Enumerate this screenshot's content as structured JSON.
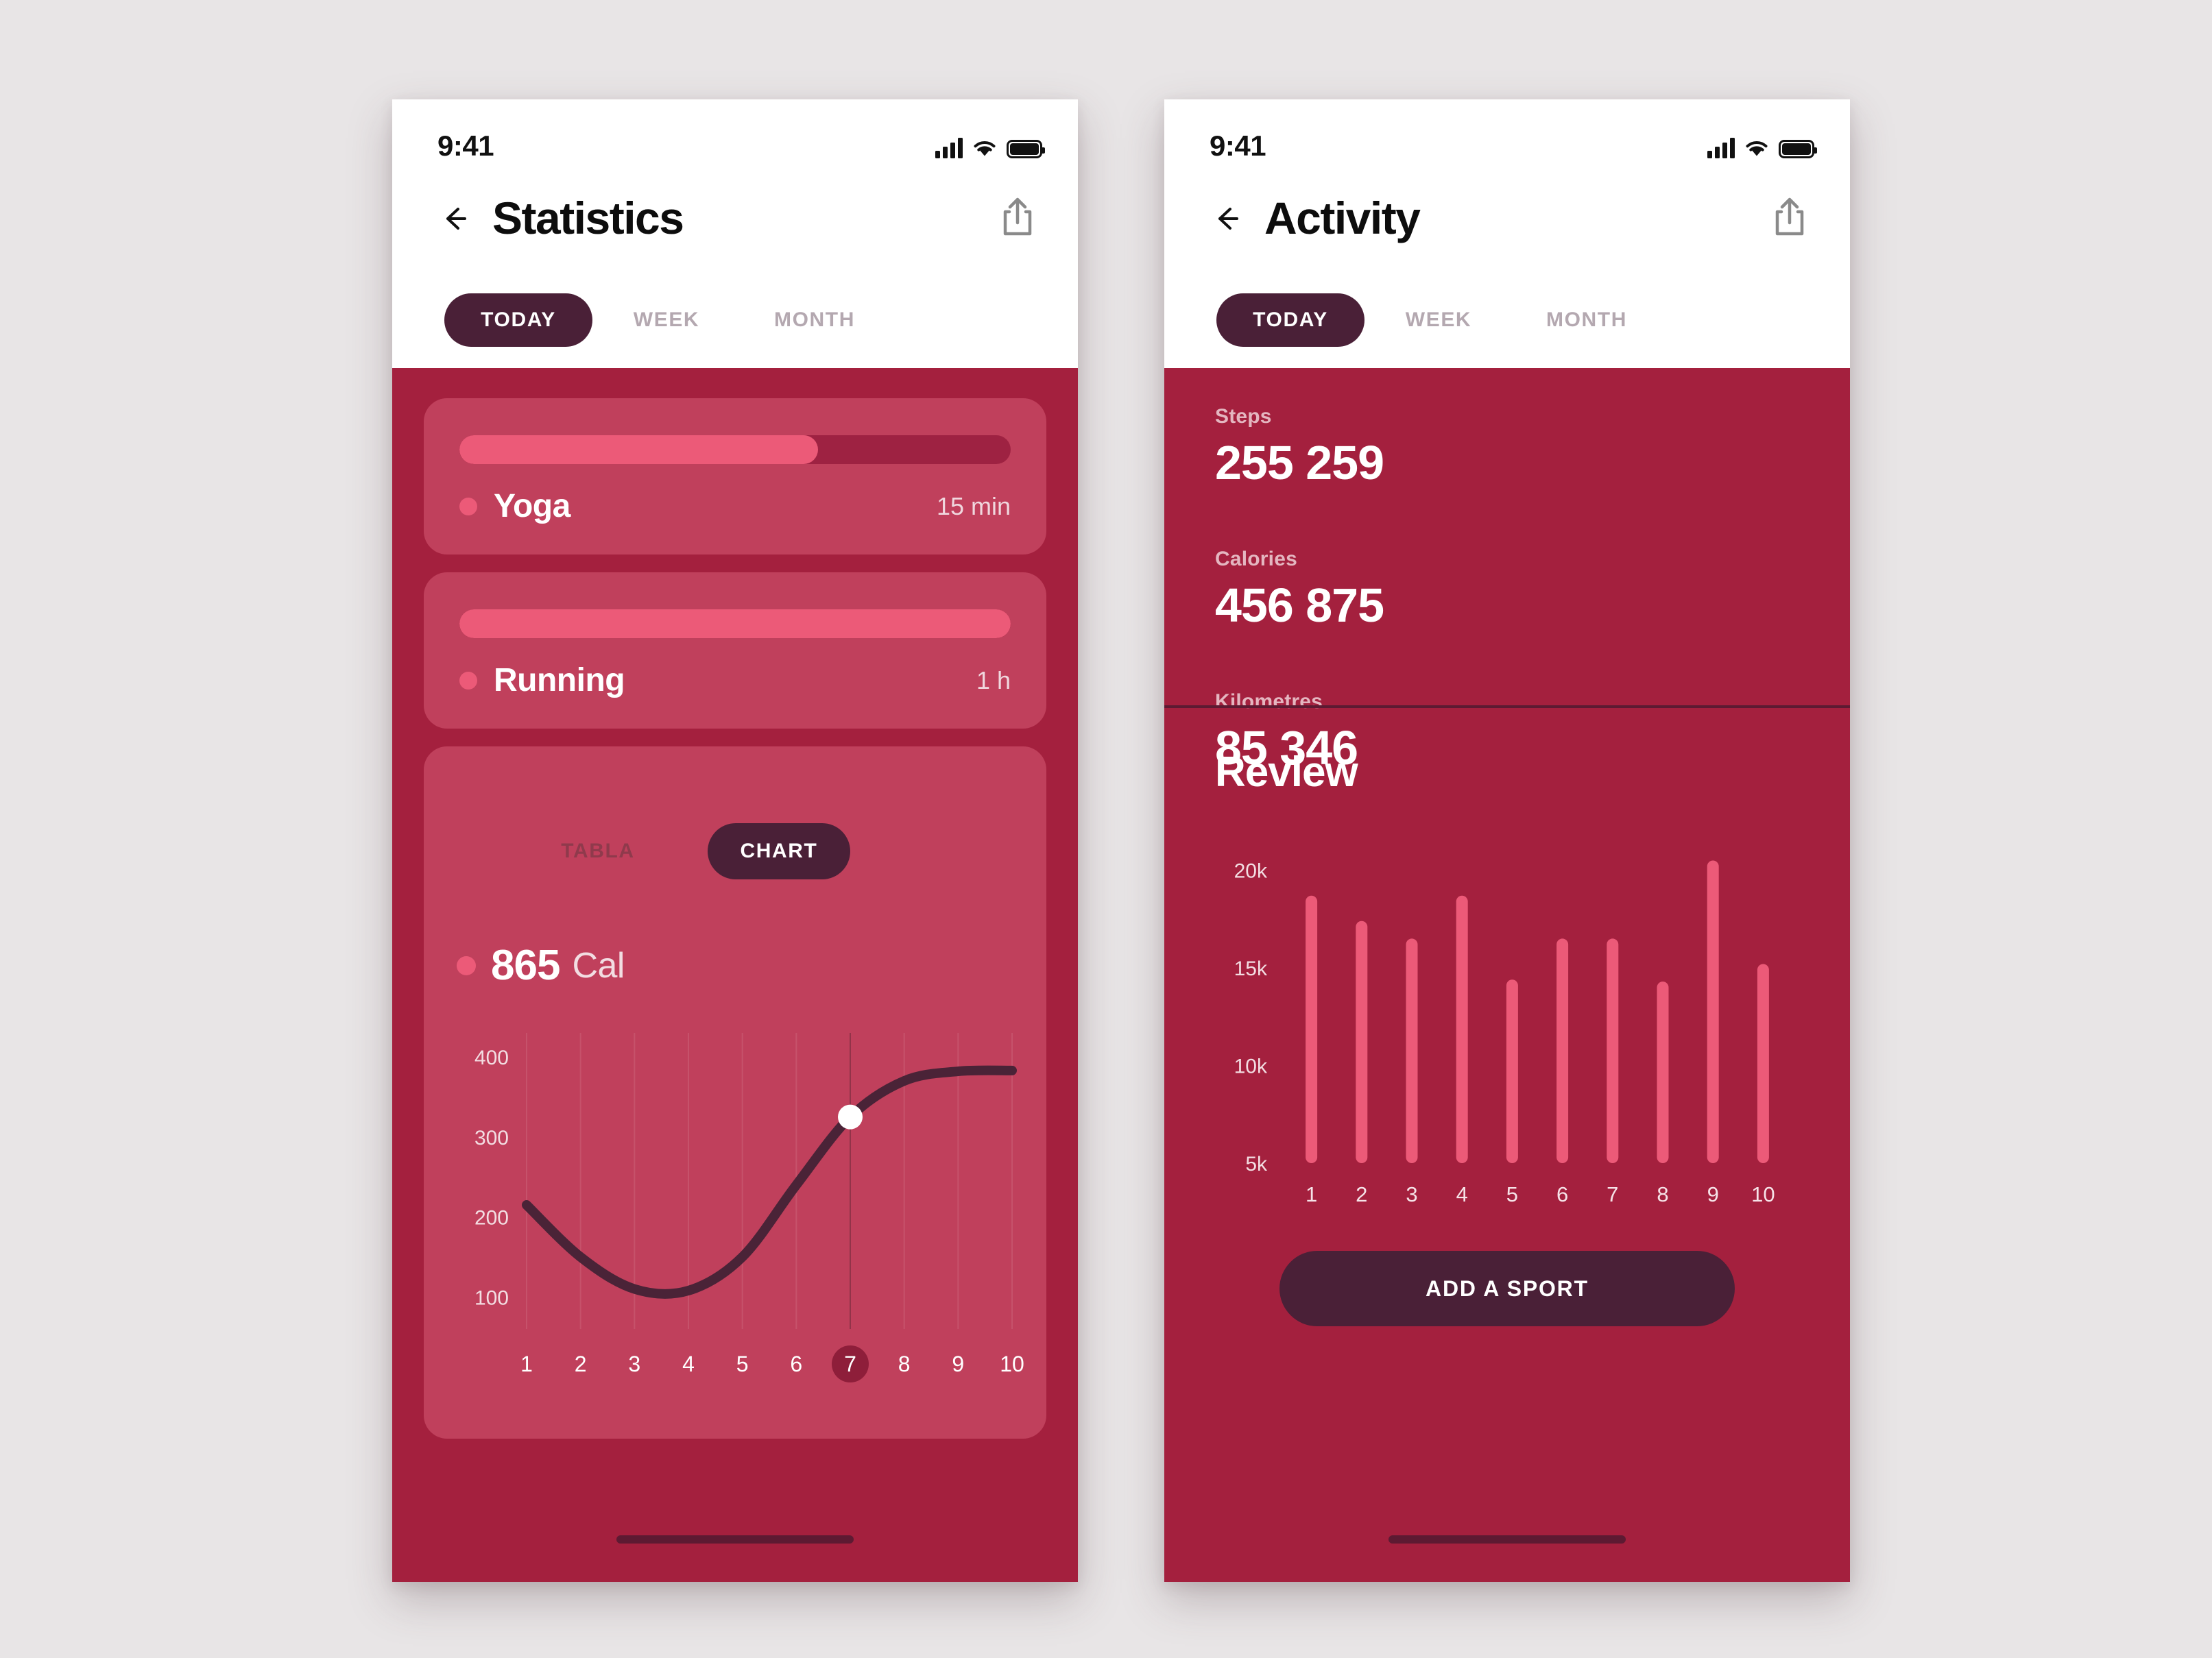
{
  "theme": {
    "page_bg": "#E8E5E6",
    "screen_bg": "#A4203E",
    "card_bg": "#C0405C",
    "accent_pink": "#EC5A78",
    "dark_plum": "#4A2037",
    "track": "#9E2242",
    "muted_tab": "#B4A8B0"
  },
  "screens": [
    {
      "id": "statistics",
      "status_bar": {
        "time": "9:41",
        "signal_icon": "cellular-signal-icon",
        "wifi_icon": "wifi-icon",
        "battery_icon": "battery-full-icon"
      },
      "nav": {
        "back_icon": "arrow-left-icon",
        "title": "Statistics",
        "share_icon": "share-icon"
      },
      "tabs": [
        {
          "label": "TODAY",
          "active": true
        },
        {
          "label": "WEEK",
          "active": false
        },
        {
          "label": "MONTH",
          "active": false
        }
      ],
      "activities": [
        {
          "name": "Yoga",
          "duration": "15 min",
          "progress_percent": 65
        },
        {
          "name": "Running",
          "duration": "1 h",
          "progress_percent": 100
        }
      ],
      "chart_card": {
        "segments": [
          {
            "label": "TABLA",
            "active": false
          },
          {
            "label": "CHART",
            "active": true
          }
        ],
        "total_value": "865",
        "total_unit": "Cal"
      }
    },
    {
      "id": "activity",
      "status_bar": {
        "time": "9:41",
        "signal_icon": "cellular-signal-icon",
        "wifi_icon": "wifi-icon",
        "battery_icon": "battery-full-icon"
      },
      "nav": {
        "back_icon": "arrow-left-icon",
        "title": "Activity",
        "share_icon": "share-icon"
      },
      "tabs": [
        {
          "label": "TODAY",
          "active": true
        },
        {
          "label": "WEEK",
          "active": false
        },
        {
          "label": "MONTH",
          "active": false
        }
      ],
      "metrics": [
        {
          "label": "Steps",
          "value": "255 259"
        },
        {
          "label": "Calories",
          "value": "456 875"
        },
        {
          "label": "Kilometres",
          "value": "85 346"
        }
      ],
      "review_title": "Review",
      "add_sport_label": "ADD A SPORT"
    }
  ],
  "chart_data": [
    {
      "type": "line",
      "title": "865 Cal",
      "xlabel": "",
      "ylabel": "",
      "x": [
        1,
        2,
        3,
        4,
        5,
        6,
        7,
        8,
        9,
        10
      ],
      "xticklabels": [
        "1",
        "2",
        "3",
        "4",
        "5",
        "6",
        "7",
        "8",
        "9",
        "10"
      ],
      "yticks": [
        100,
        200,
        300,
        400
      ],
      "yticklabels": [
        "100",
        "200",
        "300",
        "400"
      ],
      "ylim": [
        60,
        430
      ],
      "values": [
        215,
        150,
        110,
        108,
        150,
        240,
        325,
        370,
        382,
        383
      ],
      "highlight_x": 7,
      "highlight_label": "7",
      "highlight_value": 325,
      "marker": "white-dot",
      "line_color": "#4A2337",
      "grid": "vertical-only",
      "legend": "none"
    },
    {
      "type": "bar",
      "title": "Review",
      "xlabel": "",
      "ylabel": "",
      "categories": [
        "1",
        "2",
        "3",
        "4",
        "5",
        "6",
        "7",
        "8",
        "9",
        "10"
      ],
      "values": [
        18700,
        17400,
        16500,
        18700,
        14400,
        16500,
        16500,
        14300,
        20500,
        15200
      ],
      "yticks": [
        5000,
        10000,
        15000,
        20000
      ],
      "yticklabels": [
        "5k",
        "10k",
        "15k",
        "20k"
      ],
      "ylim": [
        5000,
        21500
      ],
      "bar_color": "#EC5A78",
      "grid": "off",
      "legend": "none"
    }
  ]
}
